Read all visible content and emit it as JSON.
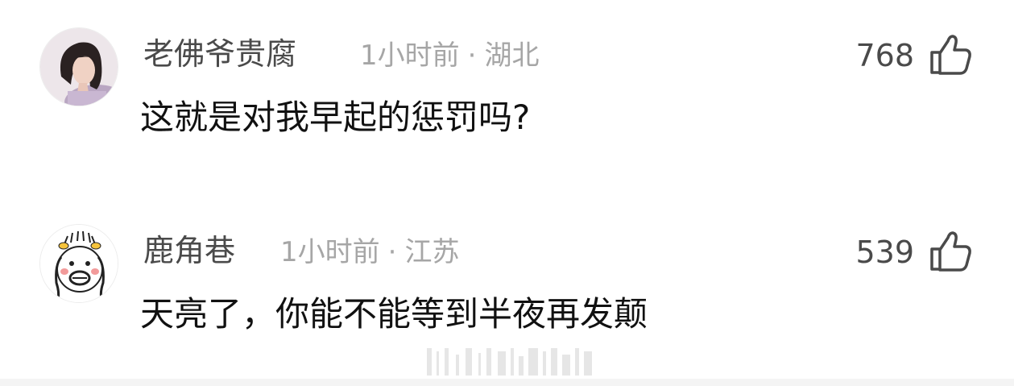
{
  "comments": [
    {
      "username": "老佛爷贵腐",
      "time": "1小时前",
      "location": "湖北",
      "text": "这就是对我早起的惩罚吗?",
      "likes": "768",
      "avatar": "portrait-photo-avatar"
    },
    {
      "username": "鹿角巷",
      "time": "1小时前",
      "location": "江苏",
      "text": "天亮了，你能不能等到半夜再发颠",
      "likes": "539",
      "avatar": "cartoon-face-avatar"
    }
  ],
  "separator": "·",
  "colors": {
    "username": "#4a4a4a",
    "meta": "#a6a6a6",
    "text": "#111111",
    "icon": "#4a4a4a",
    "footer": "#f4f4f4"
  }
}
